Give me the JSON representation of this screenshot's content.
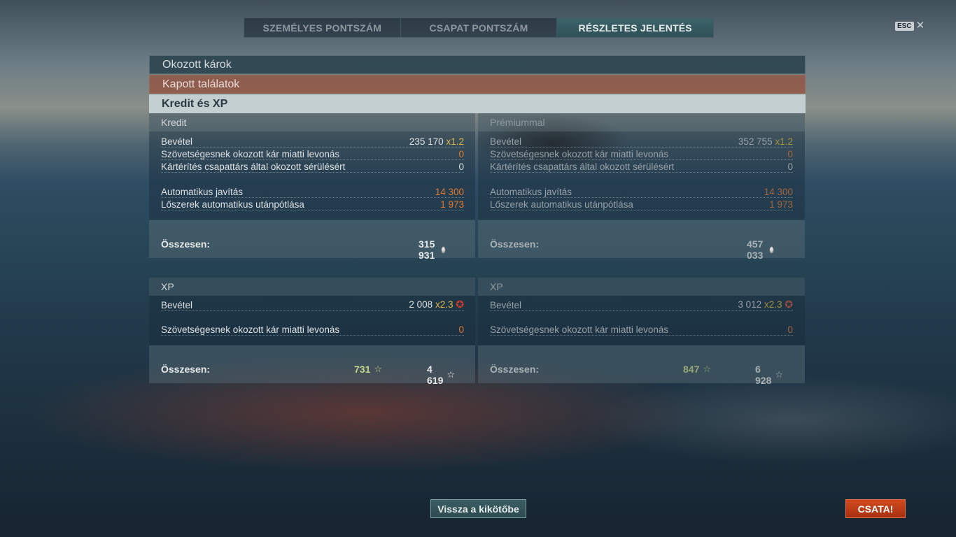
{
  "tabs": {
    "personal": "SZEMÉLYES PONTSZÁM",
    "team": "CSAPAT PONTSZÁM",
    "detailed": "RÉSZLETES JELENTÉS"
  },
  "esc": {
    "key": "ESC",
    "close": "✕"
  },
  "sections": {
    "damage_dealt": "Okozott károk",
    "hits_received": "Kapott találatok",
    "credits_xp": "Kredit és XP"
  },
  "credit": {
    "header": "Kredit",
    "income_label": "Bevétel",
    "income_value": "235 170",
    "income_mult": "x1.2",
    "ally_damage_label": "Szövetségesnek okozott kár miatti levonás",
    "ally_damage_value": "0",
    "compensation_label": "Kártérítés csapattárs által okozott sérülésért",
    "compensation_value": "0",
    "repair_label": "Automatikus javítás",
    "repair_value": "14 300",
    "ammo_label": "Lőszerek automatikus utánpótlása",
    "ammo_value": "1 973",
    "total_label": "Összesen:",
    "total_value": "315 931"
  },
  "credit_premium": {
    "header": "Prémiummal",
    "income_label": "Bevétel",
    "income_value": "352 755",
    "income_mult": "x1.2",
    "ally_damage_label": "Szövetségesnek okozott kár miatti levonás",
    "ally_damage_value": "0",
    "compensation_label": "Kártérítés csapattárs által okozott sérülésért",
    "compensation_value": "0",
    "repair_label": "Automatikus javítás",
    "repair_value": "14 300",
    "ammo_label": "Lőszerek automatikus utánpótlása",
    "ammo_value": "1 973",
    "total_label": "Összesen:",
    "total_value": "457 033"
  },
  "xp": {
    "header": "XP",
    "income_label": "Bevétel",
    "income_value": "2 008",
    "income_mult": "x2.3",
    "ally_damage_label": "Szövetségesnek okozott kár miatti levonás",
    "ally_damage_value": "0",
    "total_label": "Összesen:",
    "total_free": "731",
    "total_value": "4 619"
  },
  "xp_premium": {
    "header": "XP",
    "income_label": "Bevétel",
    "income_value": "3 012",
    "income_mult": "x2.3",
    "ally_damage_label": "Szövetségesnek okozott kár miatti levonás",
    "ally_damage_value": "0",
    "total_label": "Összesen:",
    "total_free": "847",
    "total_value": "6 928"
  },
  "icons": {
    "star": "☆",
    "star_multiplier": "✪"
  },
  "buttons": {
    "back": "Vissza a kikötőbe",
    "battle": "CSATA!"
  },
  "colors": {
    "accent_orange": "#e2782e",
    "multiplier": "#e0b64a",
    "battle_button": "#c23d17",
    "active_tab": "#3d6369"
  }
}
